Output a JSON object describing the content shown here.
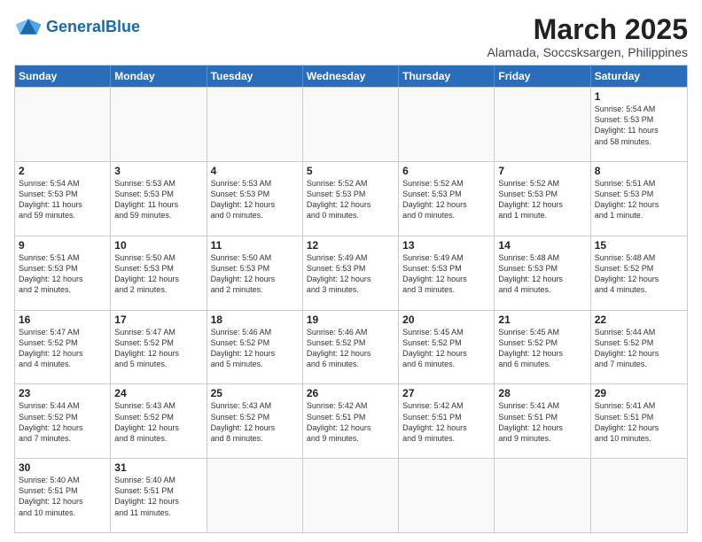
{
  "logo": {
    "general": "General",
    "blue": "Blue"
  },
  "title": {
    "month": "March 2025",
    "location": "Alamada, Soccsksargen, Philippines"
  },
  "weekdays": [
    "Sunday",
    "Monday",
    "Tuesday",
    "Wednesday",
    "Thursday",
    "Friday",
    "Saturday"
  ],
  "rows": [
    [
      {
        "day": "",
        "info": ""
      },
      {
        "day": "",
        "info": ""
      },
      {
        "day": "",
        "info": ""
      },
      {
        "day": "",
        "info": ""
      },
      {
        "day": "",
        "info": ""
      },
      {
        "day": "",
        "info": ""
      },
      {
        "day": "1",
        "info": "Sunrise: 5:54 AM\nSunset: 5:53 PM\nDaylight: 11 hours\nand 58 minutes."
      }
    ],
    [
      {
        "day": "2",
        "info": "Sunrise: 5:54 AM\nSunset: 5:53 PM\nDaylight: 11 hours\nand 59 minutes."
      },
      {
        "day": "3",
        "info": "Sunrise: 5:53 AM\nSunset: 5:53 PM\nDaylight: 11 hours\nand 59 minutes."
      },
      {
        "day": "4",
        "info": "Sunrise: 5:53 AM\nSunset: 5:53 PM\nDaylight: 12 hours\nand 0 minutes."
      },
      {
        "day": "5",
        "info": "Sunrise: 5:52 AM\nSunset: 5:53 PM\nDaylight: 12 hours\nand 0 minutes."
      },
      {
        "day": "6",
        "info": "Sunrise: 5:52 AM\nSunset: 5:53 PM\nDaylight: 12 hours\nand 0 minutes."
      },
      {
        "day": "7",
        "info": "Sunrise: 5:52 AM\nSunset: 5:53 PM\nDaylight: 12 hours\nand 1 minute."
      },
      {
        "day": "8",
        "info": "Sunrise: 5:51 AM\nSunset: 5:53 PM\nDaylight: 12 hours\nand 1 minute."
      }
    ],
    [
      {
        "day": "9",
        "info": "Sunrise: 5:51 AM\nSunset: 5:53 PM\nDaylight: 12 hours\nand 2 minutes."
      },
      {
        "day": "10",
        "info": "Sunrise: 5:50 AM\nSunset: 5:53 PM\nDaylight: 12 hours\nand 2 minutes."
      },
      {
        "day": "11",
        "info": "Sunrise: 5:50 AM\nSunset: 5:53 PM\nDaylight: 12 hours\nand 2 minutes."
      },
      {
        "day": "12",
        "info": "Sunrise: 5:49 AM\nSunset: 5:53 PM\nDaylight: 12 hours\nand 3 minutes."
      },
      {
        "day": "13",
        "info": "Sunrise: 5:49 AM\nSunset: 5:53 PM\nDaylight: 12 hours\nand 3 minutes."
      },
      {
        "day": "14",
        "info": "Sunrise: 5:48 AM\nSunset: 5:53 PM\nDaylight: 12 hours\nand 4 minutes."
      },
      {
        "day": "15",
        "info": "Sunrise: 5:48 AM\nSunset: 5:52 PM\nDaylight: 12 hours\nand 4 minutes."
      }
    ],
    [
      {
        "day": "16",
        "info": "Sunrise: 5:47 AM\nSunset: 5:52 PM\nDaylight: 12 hours\nand 4 minutes."
      },
      {
        "day": "17",
        "info": "Sunrise: 5:47 AM\nSunset: 5:52 PM\nDaylight: 12 hours\nand 5 minutes."
      },
      {
        "day": "18",
        "info": "Sunrise: 5:46 AM\nSunset: 5:52 PM\nDaylight: 12 hours\nand 5 minutes."
      },
      {
        "day": "19",
        "info": "Sunrise: 5:46 AM\nSunset: 5:52 PM\nDaylight: 12 hours\nand 6 minutes."
      },
      {
        "day": "20",
        "info": "Sunrise: 5:45 AM\nSunset: 5:52 PM\nDaylight: 12 hours\nand 6 minutes."
      },
      {
        "day": "21",
        "info": "Sunrise: 5:45 AM\nSunset: 5:52 PM\nDaylight: 12 hours\nand 6 minutes."
      },
      {
        "day": "22",
        "info": "Sunrise: 5:44 AM\nSunset: 5:52 PM\nDaylight: 12 hours\nand 7 minutes."
      }
    ],
    [
      {
        "day": "23",
        "info": "Sunrise: 5:44 AM\nSunset: 5:52 PM\nDaylight: 12 hours\nand 7 minutes."
      },
      {
        "day": "24",
        "info": "Sunrise: 5:43 AM\nSunset: 5:52 PM\nDaylight: 12 hours\nand 8 minutes."
      },
      {
        "day": "25",
        "info": "Sunrise: 5:43 AM\nSunset: 5:52 PM\nDaylight: 12 hours\nand 8 minutes."
      },
      {
        "day": "26",
        "info": "Sunrise: 5:42 AM\nSunset: 5:51 PM\nDaylight: 12 hours\nand 9 minutes."
      },
      {
        "day": "27",
        "info": "Sunrise: 5:42 AM\nSunset: 5:51 PM\nDaylight: 12 hours\nand 9 minutes."
      },
      {
        "day": "28",
        "info": "Sunrise: 5:41 AM\nSunset: 5:51 PM\nDaylight: 12 hours\nand 9 minutes."
      },
      {
        "day": "29",
        "info": "Sunrise: 5:41 AM\nSunset: 5:51 PM\nDaylight: 12 hours\nand 10 minutes."
      }
    ],
    [
      {
        "day": "30",
        "info": "Sunrise: 5:40 AM\nSunset: 5:51 PM\nDaylight: 12 hours\nand 10 minutes."
      },
      {
        "day": "31",
        "info": "Sunrise: 5:40 AM\nSunset: 5:51 PM\nDaylight: 12 hours\nand 11 minutes."
      },
      {
        "day": "",
        "info": ""
      },
      {
        "day": "",
        "info": ""
      },
      {
        "day": "",
        "info": ""
      },
      {
        "day": "",
        "info": ""
      },
      {
        "day": "",
        "info": ""
      }
    ]
  ]
}
